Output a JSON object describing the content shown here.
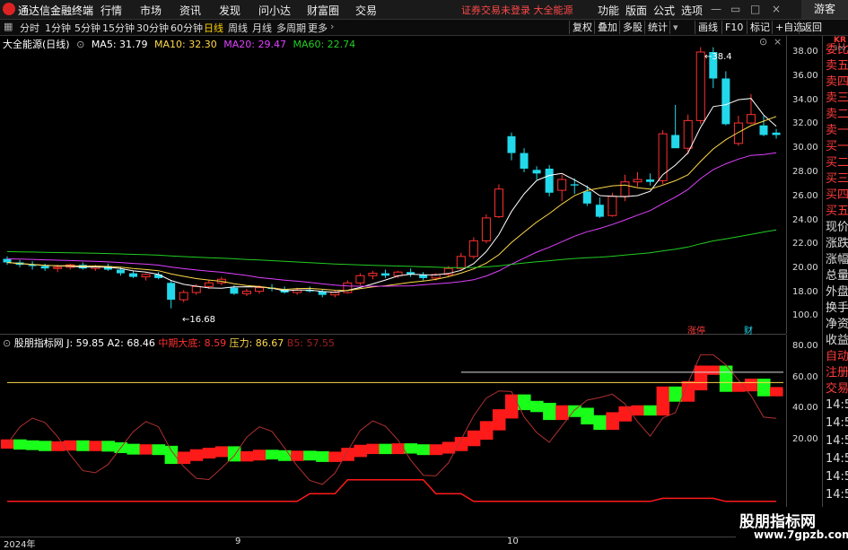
{
  "app": {
    "title": "通达信金融终端",
    "warning": "证券交易未登录",
    "warning_link": "大全能源",
    "guest": "游客"
  },
  "menu": [
    "行情",
    "市场",
    "资讯",
    "发现",
    "问小达",
    "财富圈",
    "交易"
  ],
  "top_right": [
    "功能",
    "版面",
    "公式",
    "选项"
  ],
  "periods": [
    "分时",
    "1分钟",
    "5分钟",
    "15分钟",
    "30分钟",
    "60分钟",
    "日线",
    "周线",
    "月线",
    "多周期",
    "更多"
  ],
  "active_period": "日线",
  "toolbar": [
    "复权",
    "叠加",
    "多股",
    "统计",
    "画线",
    "F10",
    "标记",
    "+自选",
    "返回"
  ],
  "main_info": {
    "name": "大全能源(日线)",
    "ma5": "MA5: 31.79",
    "ma10": "MA10: 32.30",
    "ma20": "MA20: 29.47",
    "ma60": "MA60: 22.74"
  },
  "sub_info": {
    "name": "股朋指标网",
    "j": "J: 59.85",
    "a2": "A2: 68.46",
    "mid": "中期大底: 8.59",
    "pressure": "压力: 86.67",
    "b5": "B5: 57.55"
  },
  "main_axis": [
    "38.00",
    "36.00",
    "34.00",
    "32.00",
    "30.00",
    "28.00",
    "26.00",
    "24.00",
    "22.00",
    "20.00",
    "18.00"
  ],
  "sub_axis": [
    "100.0",
    "80.00",
    "60.00",
    "40.00",
    "20.00"
  ],
  "right_panel": [
    "委比",
    "卖五",
    "卖四",
    "卖三",
    "卖二",
    "卖一",
    "买一",
    "买二",
    "买三",
    "买四",
    "买五",
    "现价",
    "涨跌",
    "涨幅",
    "总量",
    "外盘",
    "换手",
    "净资",
    "收益",
    "自动",
    "注册",
    "交易",
    "14:56",
    "14:56",
    "14:56",
    "14:56",
    "14:56",
    "14:56",
    "14:56",
    "14:56"
  ],
  "kr": "KR",
  "kr_sub": "300",
  "annotations": {
    "high": "38.4",
    "low": "16.68",
    "zt": "涨停",
    "cai": "财"
  },
  "dates": [
    "2024年",
    "9",
    "10"
  ],
  "watermark": {
    "cn": "股朋指标网",
    "url": "www.7gpzb.com"
  },
  "colors": {
    "up": "#ff3030",
    "down": "#22d8ea",
    "ma5": "#ffffff",
    "ma10": "#ffd84a",
    "ma20": "#e040ff",
    "ma60": "#22cc22",
    "red": "#ff1a1a",
    "green": "#1aff1a"
  },
  "chart_data": {
    "type": "candlestick",
    "ohlc": [
      [
        20.8,
        21.0,
        20.3,
        20.5
      ],
      [
        20.5,
        20.7,
        20.1,
        20.3
      ],
      [
        20.3,
        20.6,
        19.9,
        20.2
      ],
      [
        20.2,
        20.4,
        19.8,
        20.0
      ],
      [
        20.0,
        20.3,
        19.7,
        20.1
      ],
      [
        20.1,
        20.4,
        19.9,
        20.3
      ],
      [
        20.3,
        20.5,
        19.9,
        20.0
      ],
      [
        20.0,
        20.3,
        19.8,
        20.2
      ],
      [
        20.2,
        20.4,
        19.8,
        19.9
      ],
      [
        19.9,
        20.1,
        19.4,
        19.6
      ],
      [
        19.6,
        19.8,
        19.2,
        19.3
      ],
      [
        19.3,
        19.6,
        19.0,
        19.5
      ],
      [
        19.5,
        19.7,
        19.1,
        19.2
      ],
      [
        18.8,
        19.0,
        16.68,
        17.4
      ],
      [
        17.4,
        18.2,
        17.2,
        18.0
      ],
      [
        18.0,
        18.7,
        17.8,
        18.5
      ],
      [
        18.5,
        19.0,
        18.3,
        18.8
      ],
      [
        18.8,
        19.3,
        18.6,
        19.1
      ],
      [
        18.4,
        18.6,
        17.8,
        17.9
      ],
      [
        17.9,
        18.3,
        17.7,
        18.1
      ],
      [
        18.1,
        18.6,
        17.9,
        18.4
      ],
      [
        18.4,
        18.7,
        18.1,
        18.3
      ],
      [
        18.3,
        18.5,
        17.9,
        18.0
      ],
      [
        18.0,
        18.4,
        17.8,
        18.2
      ],
      [
        18.2,
        18.5,
        18.0,
        18.1
      ],
      [
        18.1,
        18.3,
        17.6,
        17.8
      ],
      [
        17.8,
        18.2,
        17.6,
        18.0
      ],
      [
        18.0,
        19.0,
        17.9,
        18.8
      ],
      [
        18.8,
        19.6,
        18.6,
        19.4
      ],
      [
        19.4,
        19.8,
        19.1,
        19.6
      ],
      [
        19.6,
        19.9,
        19.2,
        19.4
      ],
      [
        19.4,
        19.8,
        19.2,
        19.7
      ],
      [
        19.7,
        20.0,
        19.3,
        19.5
      ],
      [
        19.5,
        19.7,
        19.0,
        19.2
      ],
      [
        19.2,
        19.6,
        19.0,
        19.5
      ],
      [
        19.5,
        20.2,
        19.3,
        20.0
      ],
      [
        20.0,
        21.3,
        19.9,
        21.0
      ],
      [
        21.0,
        22.6,
        20.8,
        22.3
      ],
      [
        22.3,
        24.5,
        22.1,
        24.2
      ],
      [
        24.3,
        27.0,
        24.2,
        26.6
      ],
      [
        31.0,
        31.3,
        29.0,
        29.6
      ],
      [
        29.6,
        30.0,
        28.0,
        28.3
      ],
      [
        28.2,
        28.5,
        27.4,
        27.9
      ],
      [
        28.3,
        28.6,
        26.0,
        26.3
      ],
      [
        26.5,
        27.8,
        25.6,
        27.4
      ],
      [
        27.0,
        27.5,
        26.2,
        26.9
      ],
      [
        26.4,
        26.9,
        25.2,
        25.4
      ],
      [
        25.3,
        25.9,
        24.2,
        24.3
      ],
      [
        24.4,
        26.3,
        24.3,
        26.0
      ],
      [
        26.0,
        27.8,
        25.6,
        27.2
      ],
      [
        27.2,
        28.0,
        26.8,
        27.4
      ],
      [
        27.4,
        27.9,
        26.9,
        27.2
      ],
      [
        27.3,
        31.5,
        27.0,
        31.2
      ],
      [
        31.1,
        33.6,
        30.6,
        30.0
      ],
      [
        30.0,
        32.8,
        29.5,
        32.3
      ],
      [
        32.3,
        38.4,
        32.0,
        38.0
      ],
      [
        38.0,
        38.4,
        35.0,
        35.8
      ],
      [
        35.8,
        36.4,
        31.9,
        32.0
      ],
      [
        30.4,
        32.7,
        30.2,
        32.1
      ],
      [
        32.1,
        34.5,
        32.0,
        32.8
      ],
      [
        31.9,
        32.7,
        31.0,
        31.1
      ],
      [
        31.3,
        31.6,
        30.8,
        31.1
      ]
    ],
    "ma_axis_range": [
      16.68,
      38.4
    ],
    "sub_range": [
      0,
      100
    ],
    "pressure": 86.67,
    "line_80": 80
  }
}
